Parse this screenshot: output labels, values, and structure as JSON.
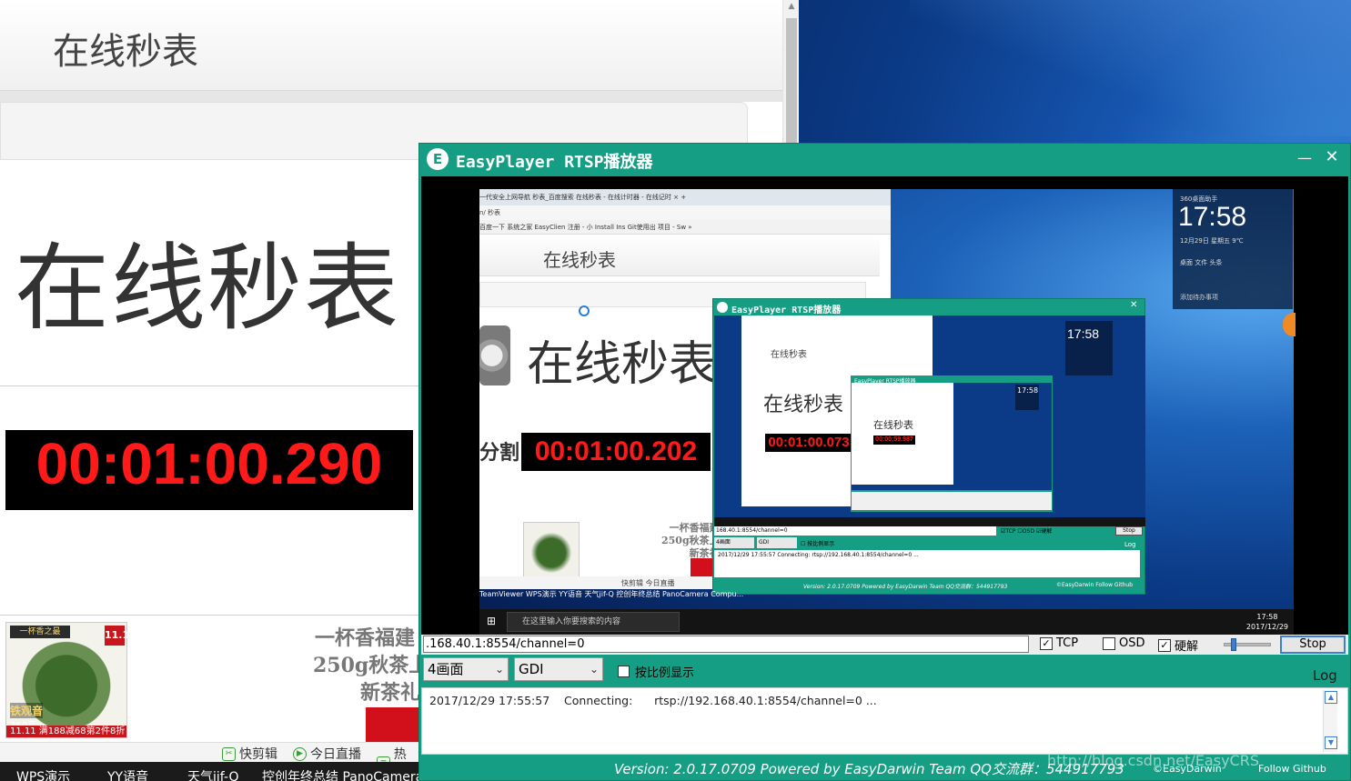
{
  "browser": {
    "header_title": "在线秒表",
    "big_title": "在线秒表",
    "timer": "00:01:00.290",
    "ad": {
      "brand": "一杯香之最",
      "badge": "11.11",
      "name": "铁观音",
      "weight": "250克",
      "promo": "11.11 满188减68第2件8折",
      "line1": "一杯香福建",
      "line2": "250g秋茶上",
      "line3": "新茶礼"
    },
    "status": {
      "quick_cut": "快剪辑",
      "live": "今日直播",
      "hot": "热点"
    },
    "taskbar": [
      "WPS演示",
      "YY语音",
      "天气jif-Q",
      "控创年终总结 PanoCamera",
      "Compu..."
    ]
  },
  "player": {
    "logo_letter": "E",
    "title": "EasyPlayer RTSP播放器",
    "minimize": "—",
    "close": "✕",
    "video": {
      "tabs": "一代安全上网导航   秒表_百度搜索   在线秒表 - 在线计时器 - 在线记时 ×  +",
      "nav": "n/                                                              秒表",
      "bookmarks": "百度一下  系统之家  EasyClien  注册 - 小  Install Ins  Git使用出  项目 - Sw  »",
      "head_title": "在线秒表",
      "big_title": "在线秒表",
      "split": "分割",
      "timer": "00:01:00.202",
      "ad_text": "一杯香福建\n250g秋茶上\n新茶礼",
      "status": "快剪辑   今日直播",
      "taskbar_labels": "TeamViewer   WPS演示    YY语音     天气jif-Q   控创年终总结 PanoCamera  Compu...",
      "search": "在这里输入你要搜索的内容",
      "time": "17:58",
      "date": "2017/12/29",
      "widget": {
        "name": "360桌面助手",
        "time": "17:58",
        "date_line": "12月29日   星期五        9℃",
        "links": "桌面    文件    头条",
        "todo": "添加待办事项"
      },
      "nested": {
        "title": "EasyPlayer RTSP播放器",
        "close": "✕",
        "head": "在线秒表",
        "big": "在线秒表",
        "timer": "00:01:00.073",
        "widget_time": "17:58",
        "inner_title": "EasyPlayer RTSP播放器",
        "inner_big": "在线秒表",
        "inner_timer": "00:00:59.987",
        "inner_widget_time": "17:58",
        "url": "168.40.1:8554/channel=0",
        "opts": "☑TCP  ☐OSD  ☑硬解",
        "stop": "Stop",
        "select1": "4画面",
        "select2": "GDI",
        "ratio": "☐ 按比例显示",
        "log_label": "Log",
        "log": "2017/12/29 17:55:57   Connecting:     rtsp://192.168.40.1:8554/channel=0 ...",
        "footer": "Version: 2.0.17.0709 Powered by EasyDarwin Team QQ交流群：544917793",
        "footer_right": "©EasyDarwin    Follow Github"
      }
    },
    "url": ".168.40.1:8554/channel=0",
    "tcp_label": "TCP",
    "tcp_checked": true,
    "osd_label": "OSD",
    "osd_checked": false,
    "hw_label": "硬解",
    "hw_checked": true,
    "volume_level": 0.15,
    "stop_label": "Stop",
    "split_select": "4画面",
    "render_select": "GDI",
    "ratio_label": "按比例显示",
    "log_label": "Log",
    "log_line": "2017/12/29 17:55:57    Connecting:      rtsp://192.168.40.1:8554/channel=0 ...",
    "footer_text": "Version: 2.0.17.0709 Powered by EasyDarwin Team QQ交流群：544917793",
    "footer_easydarwin": "©EasyDarwin",
    "footer_github": "Follow Github",
    "watermark": "http://blog.csdn.net/EasyCRS"
  },
  "colors": {
    "player_green": "#159e83",
    "timer_red": "#ff1a1a",
    "accent_blue": "#3c7fd1"
  }
}
